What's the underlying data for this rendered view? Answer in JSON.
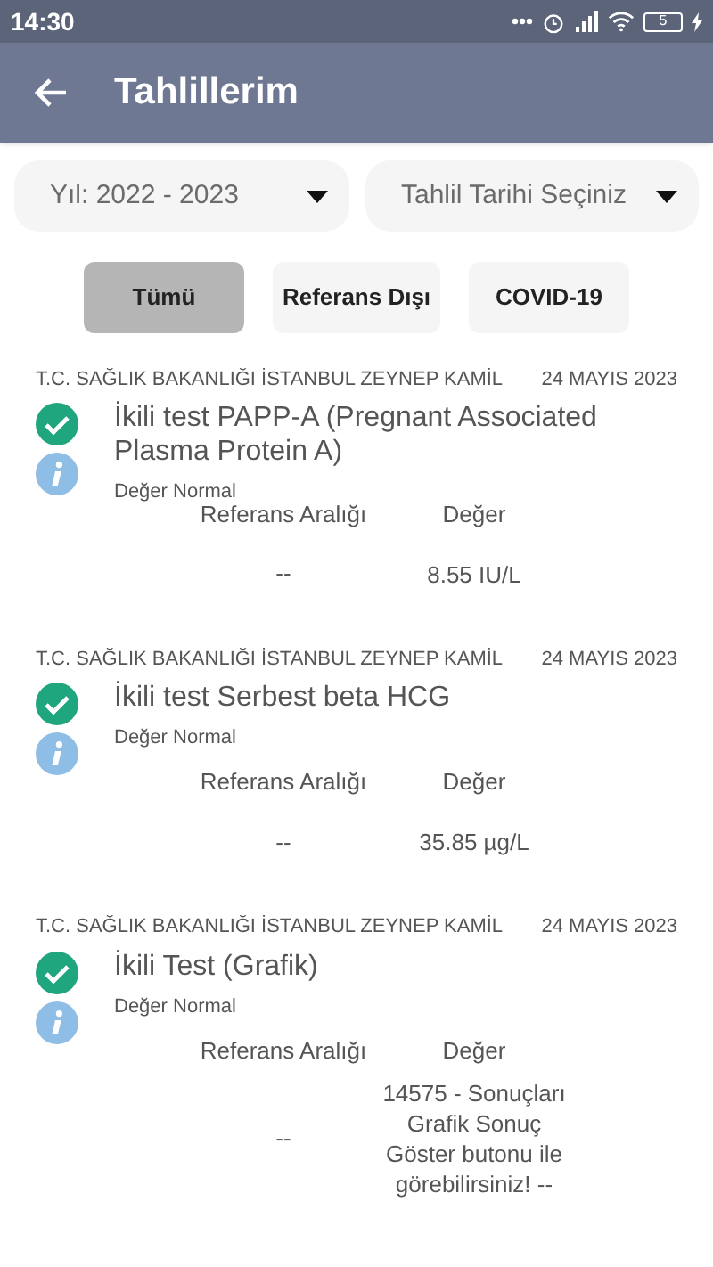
{
  "status_bar": {
    "time": "14:30",
    "battery": "5"
  },
  "app_bar": {
    "title": "Tahlillerim"
  },
  "dropdowns": [
    {
      "value": "Yıl: 2022 - 2023"
    },
    {
      "value": "Tahlil Tarihi Seçiniz"
    }
  ],
  "filters": [
    {
      "label": "Tümü",
      "selected": true
    },
    {
      "label": "Referans Dışı",
      "selected": false
    },
    {
      "label": "COVID-19",
      "selected": false
    }
  ],
  "results": [
    {
      "institution": "T.C. SAĞLIK BAKANLIĞI İSTANBUL ZEYNEP KAMİL",
      "date": "24 MAYIS 2023",
      "name": "İkili test PAPP-A (Pregnant Associated Plasma Protein A)",
      "status": "Değer Normal",
      "normal": true,
      "range_header": "Referans Aralığı",
      "value_header": "Değer",
      "range": "--",
      "value": "8.55 IU/L"
    },
    {
      "institution": "T.C. SAĞLIK BAKANLIĞI İSTANBUL ZEYNEP KAMİL",
      "date": "24 MAYIS 2023",
      "name": "İkili test Serbest beta HCG",
      "status": "Değer Normal",
      "normal": true,
      "range_header": "Referans Aralığı",
      "value_header": "Değer",
      "range": "--",
      "value": "35.85 µg/L"
    },
    {
      "institution": "T.C. SAĞLIK BAKANLIĞI İSTANBUL ZEYNEP KAMİL",
      "date": "24 MAYIS 2023",
      "name": "İkili Test (Grafik)",
      "status": "Değer Normal",
      "normal": true,
      "range_header": "Referans Aralığı",
      "value_header": "Değer",
      "range": "--",
      "value": "14575 - Sonuçları Grafik Sonuç Göster butonu ile görebilirsiniz! --"
    }
  ]
}
